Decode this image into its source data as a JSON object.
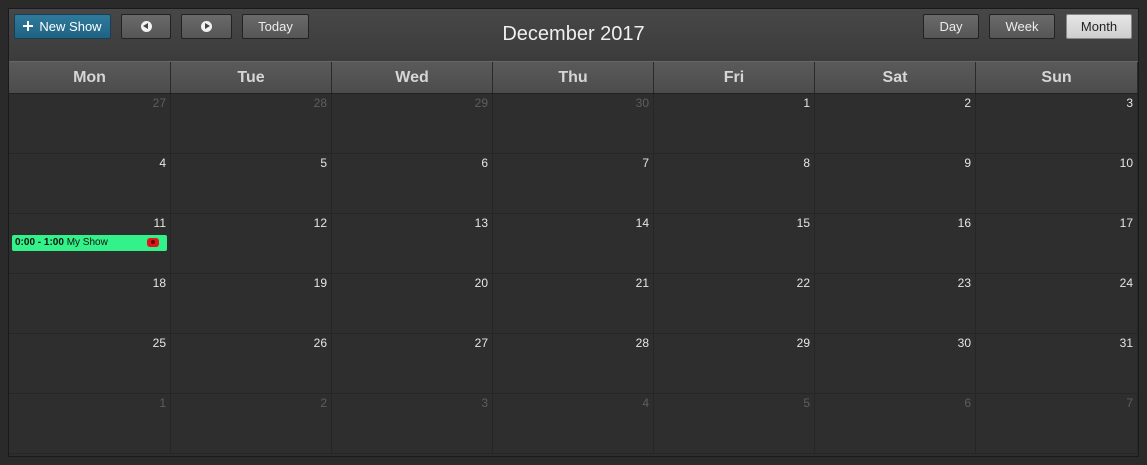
{
  "toolbar": {
    "new_show_label": "New Show",
    "prev_icon": "prev-icon",
    "next_icon": "next-icon",
    "today_label": "Today",
    "title": "December 2017",
    "views": {
      "day": "Day",
      "week": "Week",
      "month": "Month"
    },
    "active_view": "month"
  },
  "weekdays": [
    "Mon",
    "Tue",
    "Wed",
    "Thu",
    "Fri",
    "Sat",
    "Sun"
  ],
  "weeks": [
    [
      {
        "d": "27",
        "other": true
      },
      {
        "d": "28",
        "other": true
      },
      {
        "d": "29",
        "other": true
      },
      {
        "d": "30",
        "other": true
      },
      {
        "d": "1"
      },
      {
        "d": "2"
      },
      {
        "d": "3"
      }
    ],
    [
      {
        "d": "4"
      },
      {
        "d": "5"
      },
      {
        "d": "6"
      },
      {
        "d": "7"
      },
      {
        "d": "8"
      },
      {
        "d": "9"
      },
      {
        "d": "10"
      }
    ],
    [
      {
        "d": "11",
        "event": {
          "time": "0:00 - 1:00",
          "title": "My Show"
        }
      },
      {
        "d": "12"
      },
      {
        "d": "13"
      },
      {
        "d": "14"
      },
      {
        "d": "15"
      },
      {
        "d": "16"
      },
      {
        "d": "17"
      }
    ],
    [
      {
        "d": "18"
      },
      {
        "d": "19"
      },
      {
        "d": "20"
      },
      {
        "d": "21"
      },
      {
        "d": "22"
      },
      {
        "d": "23"
      },
      {
        "d": "24"
      }
    ],
    [
      {
        "d": "25"
      },
      {
        "d": "26"
      },
      {
        "d": "27"
      },
      {
        "d": "28"
      },
      {
        "d": "29"
      },
      {
        "d": "30"
      },
      {
        "d": "31"
      }
    ],
    [
      {
        "d": "1",
        "other": true
      },
      {
        "d": "2",
        "other": true
      },
      {
        "d": "3",
        "other": true
      },
      {
        "d": "4",
        "other": true
      },
      {
        "d": "5",
        "other": true
      },
      {
        "d": "6",
        "other": true
      },
      {
        "d": "7",
        "other": true
      }
    ]
  ],
  "colors": {
    "event_bg": "#33f28a",
    "primary": "#1f6282"
  }
}
